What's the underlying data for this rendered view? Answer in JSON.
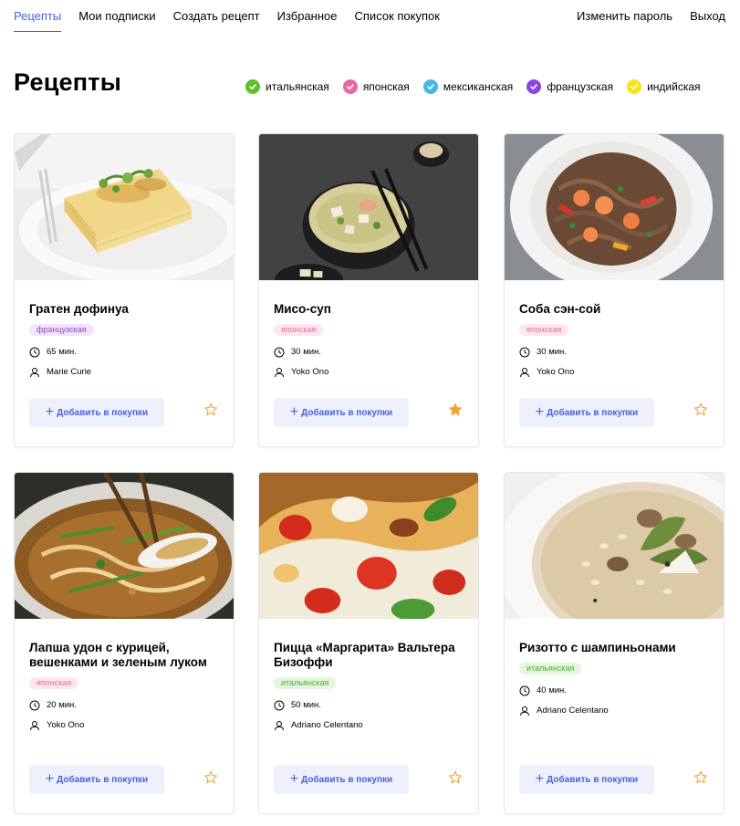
{
  "nav": {
    "items": [
      {
        "label": "Рецепты",
        "active": true
      },
      {
        "label": "Мои подписки"
      },
      {
        "label": "Создать рецепт"
      },
      {
        "label": "Избранное"
      },
      {
        "label": "Список покупок"
      }
    ],
    "right": [
      {
        "label": "Изменить пароль"
      },
      {
        "label": "Выход"
      }
    ]
  },
  "page": {
    "title": "Рецепты"
  },
  "filters": [
    {
      "label": "итальянская",
      "color": "#5fbf2d"
    },
    {
      "label": "японская",
      "color": "#ea68a2"
    },
    {
      "label": "мексиканская",
      "color": "#46b8e8"
    },
    {
      "label": "французская",
      "color": "#8c45e3"
    },
    {
      "label": "индийская",
      "color": "#f2e51c"
    }
  ],
  "cards": [
    {
      "title": "Гратен дофинуа",
      "tag": "французская",
      "time": "65 мин.",
      "author": "Marie Curie",
      "add_label": "Добавить в покупки",
      "favorite": false
    },
    {
      "title": "Мисо-суп",
      "tag": "японская",
      "time": "30 мин.",
      "author": "Yoko Ono",
      "add_label": "Добавить в покупки",
      "favorite": true
    },
    {
      "title": "Соба сэн-сой",
      "tag": "японская",
      "time": "30 мин.",
      "author": "Yoko Ono",
      "add_label": "Добавить в покупки",
      "favorite": false
    },
    {
      "title": "Лапша удон с курицей, вешенками и зеленым луком",
      "tag": "японская",
      "time": "20 мин.",
      "author": "Yoko Ono",
      "add_label": "Добавить в покупки",
      "favorite": false
    },
    {
      "title": "Пицца «Маргарита» Вальтера Бизоффи",
      "tag": "итальянская",
      "time": "50 мин.",
      "author": "Adriano Celentano",
      "add_label": "Добавить в покупки",
      "favorite": false
    },
    {
      "title": "Ризотто с шампиньонами",
      "tag": "итальянская",
      "time": "40 мин.",
      "author": "Adriano Celentano",
      "add_label": "Добавить в покупки",
      "favorite": false
    }
  ],
  "colors": {
    "accent": "#4a61dd",
    "star": "#f4a530"
  }
}
